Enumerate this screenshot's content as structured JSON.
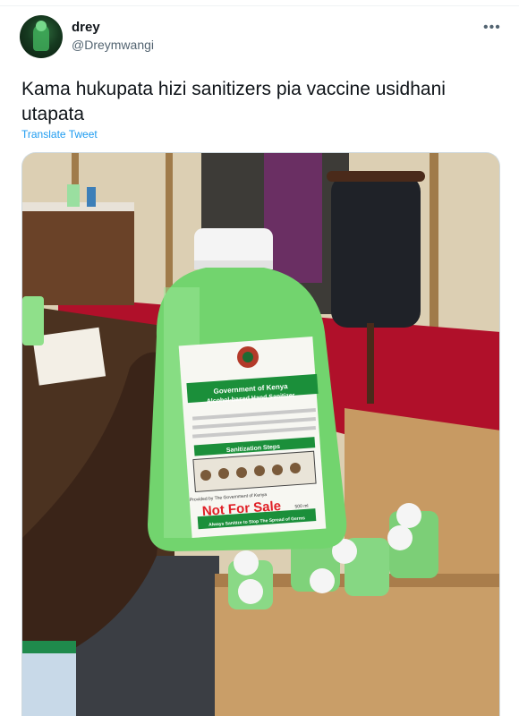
{
  "tweet": {
    "display_name": "drey",
    "handle": "@Dreymwangi",
    "more_icon": "more-horizontal-icon",
    "text": "Kama hukupata hizi sanitizers pia vaccine usidhani utapata",
    "translate_label": "Translate Tweet"
  },
  "photo": {
    "label_header_1": "Government of Kenya",
    "label_header_2": "Alcohol-based Hand Sanitizer",
    "label_section": "Sanitization Steps",
    "label_provided": "Provided by The Government of Kenya",
    "label_not_for_sale": "Not For Sale",
    "label_volume": "500 ml",
    "label_footer": "Always Sanitize to Stop The Spread of Germs"
  },
  "colors": {
    "link": "#1d9bf0",
    "handle": "#536471",
    "sanitizer_green": "#6fd36b",
    "label_red": "#e01f26",
    "label_green": "#1b8f3a"
  }
}
